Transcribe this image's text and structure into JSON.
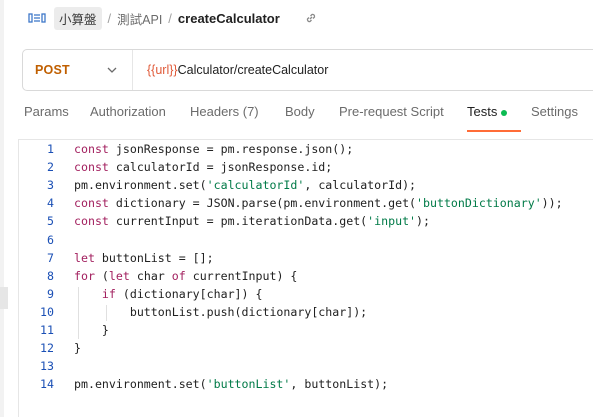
{
  "breadcrumb": {
    "icon": "api-icon",
    "collection": "小算盤",
    "folder": "測試API",
    "request": "createCalculator"
  },
  "request": {
    "method": "POST",
    "url_var": "{{url}}",
    "url_path": "Calculator/createCalculator"
  },
  "tabs": [
    {
      "label": "Params",
      "active": false
    },
    {
      "label": "Authorization",
      "active": false
    },
    {
      "label": "Headers (7)",
      "active": false
    },
    {
      "label": "Body",
      "active": false
    },
    {
      "label": "Pre-request Script",
      "active": false
    },
    {
      "label": "Tests",
      "active": true,
      "indicator": "green-dot"
    },
    {
      "label": "Settings",
      "active": false
    }
  ],
  "colors": {
    "method": "#c05f00",
    "url_var": "#e05a39",
    "active_tab": "#ff6c37",
    "dot": "#0cbb52",
    "keyword": "#a21f5e",
    "string": "#007a47",
    "line_number": "#1a4fb5"
  },
  "editor": {
    "lines": [
      {
        "num": "1",
        "text": "const jsonResponse = pm.response.json();"
      },
      {
        "num": "2",
        "text": "const calculatorId = jsonResponse.id;"
      },
      {
        "num": "3",
        "text": "pm.environment.set('calculatorId', calculatorId);"
      },
      {
        "num": "4",
        "text": "const dictionary = JSON.parse(pm.environment.get('buttonDictionary'));"
      },
      {
        "num": "5",
        "text": "const currentInput = pm.iterationData.get('input');"
      },
      {
        "num": "6",
        "text": ""
      },
      {
        "num": "7",
        "text": "let buttonList = [];"
      },
      {
        "num": "8",
        "text": "for (let char of currentInput) {"
      },
      {
        "num": "9",
        "text": "    if (dictionary[char]) {"
      },
      {
        "num": "10",
        "text": "        buttonList.push(dictionary[char]);"
      },
      {
        "num": "11",
        "text": "    }"
      },
      {
        "num": "12",
        "text": "}"
      },
      {
        "num": "13",
        "text": ""
      },
      {
        "num": "14",
        "text": "pm.environment.set('buttonList', buttonList);"
      }
    ]
  }
}
